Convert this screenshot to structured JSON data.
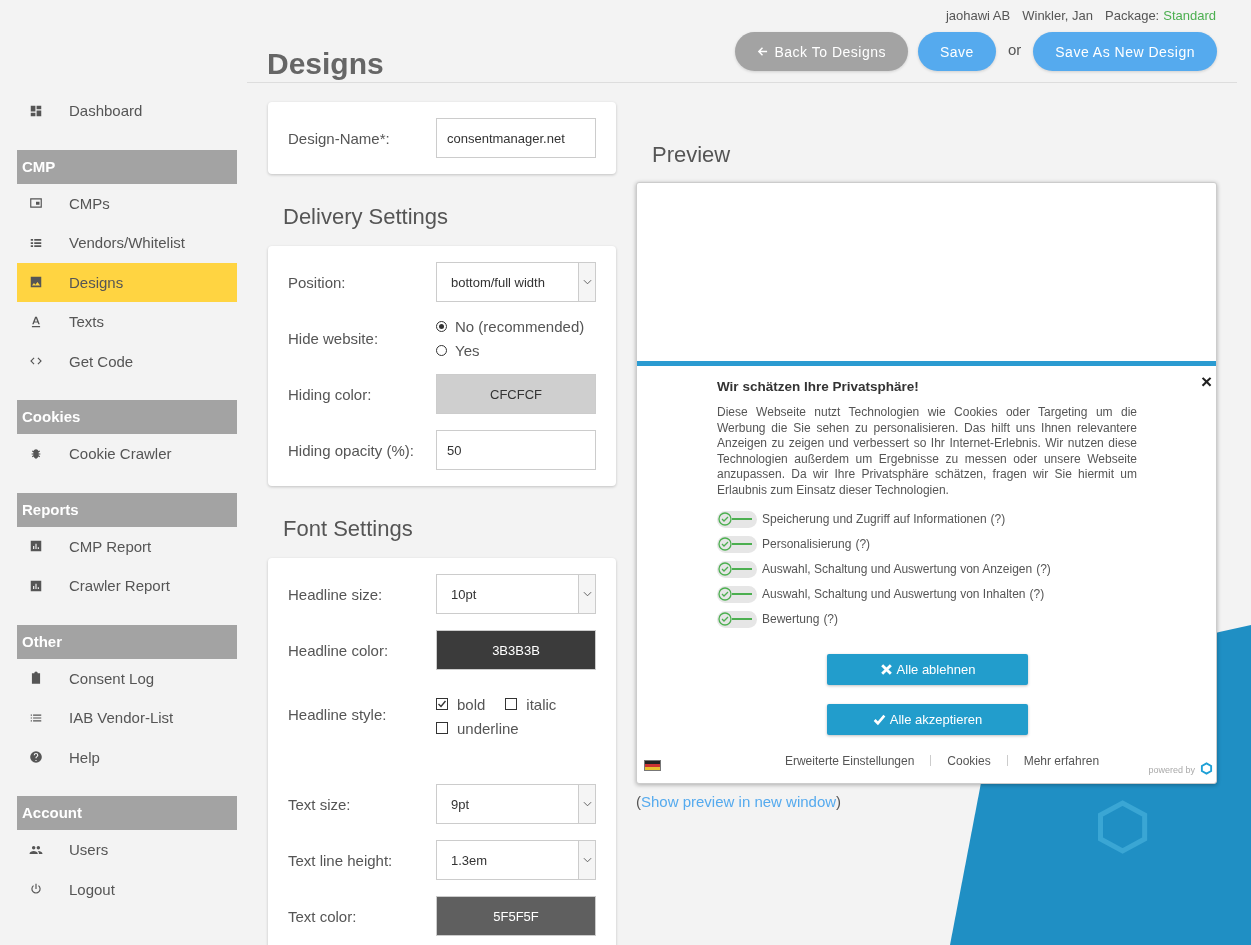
{
  "header": {
    "company": "jaohawi AB",
    "user": "Winkler, Jan",
    "package_label": "Package:",
    "package_value": "Standard"
  },
  "page_title": "Designs",
  "actions": [
    {
      "kind": "back",
      "label": "Back To Designs"
    },
    {
      "kind": "primary",
      "label": "Save"
    },
    {
      "kind": "separator",
      "label": "or"
    },
    {
      "kind": "primary",
      "label": "Save As New Design"
    }
  ],
  "sidebar": {
    "items": [
      {
        "kind": "link",
        "label": "Dashboard",
        "selected": false
      },
      {
        "kind": "section",
        "label": "CMP"
      },
      {
        "kind": "link",
        "label": "CMPs",
        "selected": false
      },
      {
        "kind": "link",
        "label": "Vendors/Whitelist",
        "selected": false
      },
      {
        "kind": "link",
        "label": "Designs",
        "selected": true
      },
      {
        "kind": "link",
        "label": "Texts",
        "selected": false
      },
      {
        "kind": "link",
        "label": "Get Code",
        "selected": false
      },
      {
        "kind": "section",
        "label": "Cookies"
      },
      {
        "kind": "link",
        "label": "Cookie Crawler",
        "selected": false
      },
      {
        "kind": "section",
        "label": "Reports"
      },
      {
        "kind": "link",
        "label": "CMP Report",
        "selected": false
      },
      {
        "kind": "link",
        "label": "Crawler Report",
        "selected": false
      },
      {
        "kind": "section",
        "label": "Other"
      },
      {
        "kind": "link",
        "label": "Consent Log",
        "selected": false
      },
      {
        "kind": "link",
        "label": "IAB Vendor-List",
        "selected": false
      },
      {
        "kind": "link",
        "label": "Help",
        "selected": false
      },
      {
        "kind": "section",
        "label": "Account"
      },
      {
        "kind": "link",
        "label": "Users",
        "selected": false
      },
      {
        "kind": "link",
        "label": "Logout",
        "selected": false
      }
    ]
  },
  "sections": [
    {
      "fields": [
        {
          "kind": "input",
          "label": "Design-Name*:",
          "value": "consentmanager.net"
        }
      ]
    },
    {
      "title": "Delivery Settings",
      "fields": [
        {
          "kind": "select",
          "label": "Position:",
          "value": "bottom/full width"
        },
        {
          "kind": "radio",
          "label": "Hide website:",
          "options": [
            {
              "label": "No (recommended)",
              "selected": true
            },
            {
              "label": "Yes",
              "selected": false
            }
          ]
        },
        {
          "kind": "color",
          "label": "Hiding color:",
          "value": "CFCFCF",
          "color": "#cfcfcf"
        },
        {
          "kind": "input",
          "label": "Hiding opacity (%):",
          "value": "50"
        }
      ]
    },
    {
      "title": "Font Settings",
      "fields": [
        {
          "kind": "select",
          "label": "Headline size:",
          "value": "10pt"
        },
        {
          "kind": "color",
          "label": "Headline color:",
          "value": "3B3B3B",
          "color": "#3b3b3b"
        },
        {
          "kind": "checkboxes",
          "label": "Headline style:",
          "options": [
            {
              "label": "bold",
              "checked": true
            },
            {
              "label": "italic",
              "checked": false
            },
            {
              "label": "underline",
              "checked": false
            }
          ]
        },
        {
          "kind": "select",
          "label": "Text size:",
          "value": "9pt"
        },
        {
          "kind": "select",
          "label": "Text line height:",
          "value": "1.3em"
        },
        {
          "kind": "color",
          "label": "Text color:",
          "value": "5F5F5F",
          "color": "#5f5f5f"
        }
      ]
    }
  ],
  "preview": {
    "title": "Preview",
    "banner": {
      "close": "×",
      "headline": "Wir schätzen Ihre Privatsphäre!",
      "body": "Diese Webseite nutzt Technologien wie Cookies oder Targeting um die Werbung die Sie sehen zu personalisieren. Das hilft uns Ihnen relevantere Anzeigen zu zeigen und verbessert so Ihr Internet-Erlebnis. Wir nutzen diese Technologien außerdem um Ergebnisse zu messen oder unsere Webseite anzupassen. Da wir Ihre Privatsphäre schätzen, fragen wir Sie hiermit um Erlaubnis zum Einsatz dieser Technologien.",
      "purposes": [
        {
          "label": "Speicherung und Zugriff auf Informationen",
          "help": "(?)",
          "checked": true
        },
        {
          "label": "Personalisierung",
          "help": "(?)",
          "checked": true
        },
        {
          "label": "Auswahl, Schaltung und Auswertung von Anzeigen",
          "help": "(?)",
          "checked": true
        },
        {
          "label": "Auswahl, Schaltung und Auswertung von Inhalten",
          "help": "(?)",
          "checked": true
        },
        {
          "label": "Bewertung",
          "help": "(?)",
          "checked": true
        }
      ],
      "buttons": [
        {
          "kind": "reject",
          "label": "Alle ablehnen"
        },
        {
          "kind": "accept",
          "label": "Alle akzeptieren"
        }
      ],
      "links": [
        "Erweiterte Einstellungen",
        "Cookies",
        "Mehr erfahren"
      ],
      "powered_by": "powered by"
    },
    "link_open": "(",
    "link": "Show preview in new window",
    "link_close": ")"
  }
}
